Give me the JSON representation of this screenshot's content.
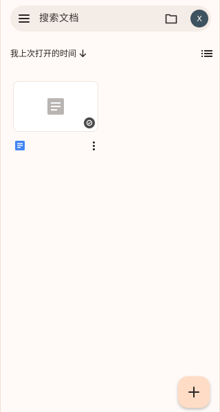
{
  "search": {
    "placeholder": "搜索文档"
  },
  "header": {
    "menu_icon": "menu-icon",
    "folder_icon": "folder-icon",
    "avatar_initial": "X",
    "avatar_color": "#3E5360"
  },
  "sort": {
    "label": "我上次打开的时间",
    "direction_icon": "arrow-down-icon",
    "view_toggle_icon": "list-view-icon"
  },
  "documents": [
    {
      "thumbnail_icon": "document-icon",
      "offline_badge_icon": "offline-available-icon",
      "type_icon": "google-docs-icon",
      "more_icon": "more-vert-icon"
    }
  ],
  "fab": {
    "icon": "add-icon",
    "color": "#FFDCC5"
  },
  "colors": {
    "background": "#FFFAF7",
    "search_bar": "#F4ECE6",
    "docs_blue": "#4285F4"
  }
}
